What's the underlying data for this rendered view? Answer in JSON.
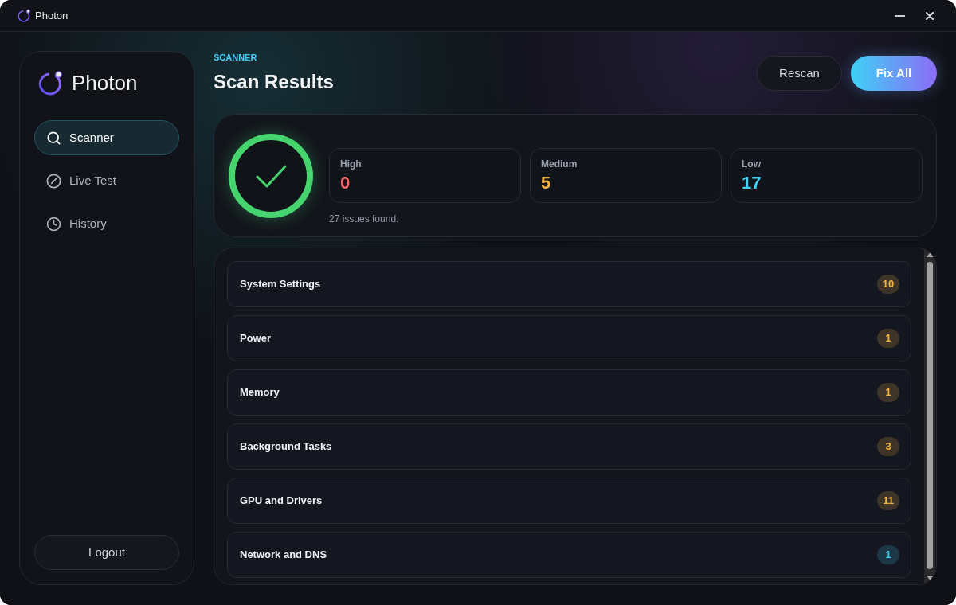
{
  "window": {
    "title": "Photon"
  },
  "sidebar": {
    "brand": "Photon",
    "items": [
      {
        "label": "Scanner",
        "selected": true
      },
      {
        "label": "Live Test",
        "selected": false
      },
      {
        "label": "History",
        "selected": false
      }
    ],
    "logout": "Logout"
  },
  "header": {
    "eyebrow": "SCANNER",
    "title": "Scan Results",
    "buttons": [
      {
        "label": "Rescan",
        "kind": "secondary"
      },
      {
        "label": "Fix All",
        "kind": "primary"
      }
    ]
  },
  "summary": {
    "stats": [
      {
        "label": "High",
        "value": "0",
        "color": "#fb6b6b"
      },
      {
        "label": "Medium",
        "value": "5",
        "color": "#f6b040"
      },
      {
        "label": "Low",
        "value": "17",
        "color": "#3fd0f5"
      }
    ],
    "note": "27 issues found."
  },
  "categories": [
    {
      "name": "System Settings",
      "count": "10",
      "color": "#f3b443"
    },
    {
      "name": "Power",
      "count": "1",
      "color": "#f3b443"
    },
    {
      "name": "Memory",
      "count": "1",
      "color": "#f3b443"
    },
    {
      "name": "Background Tasks",
      "count": "3",
      "color": "#f3b443"
    },
    {
      "name": "GPU and Drivers",
      "count": "11",
      "color": "#f3b443"
    },
    {
      "name": "Network and DNS",
      "count": "1",
      "color": "#40c8ee"
    }
  ]
}
